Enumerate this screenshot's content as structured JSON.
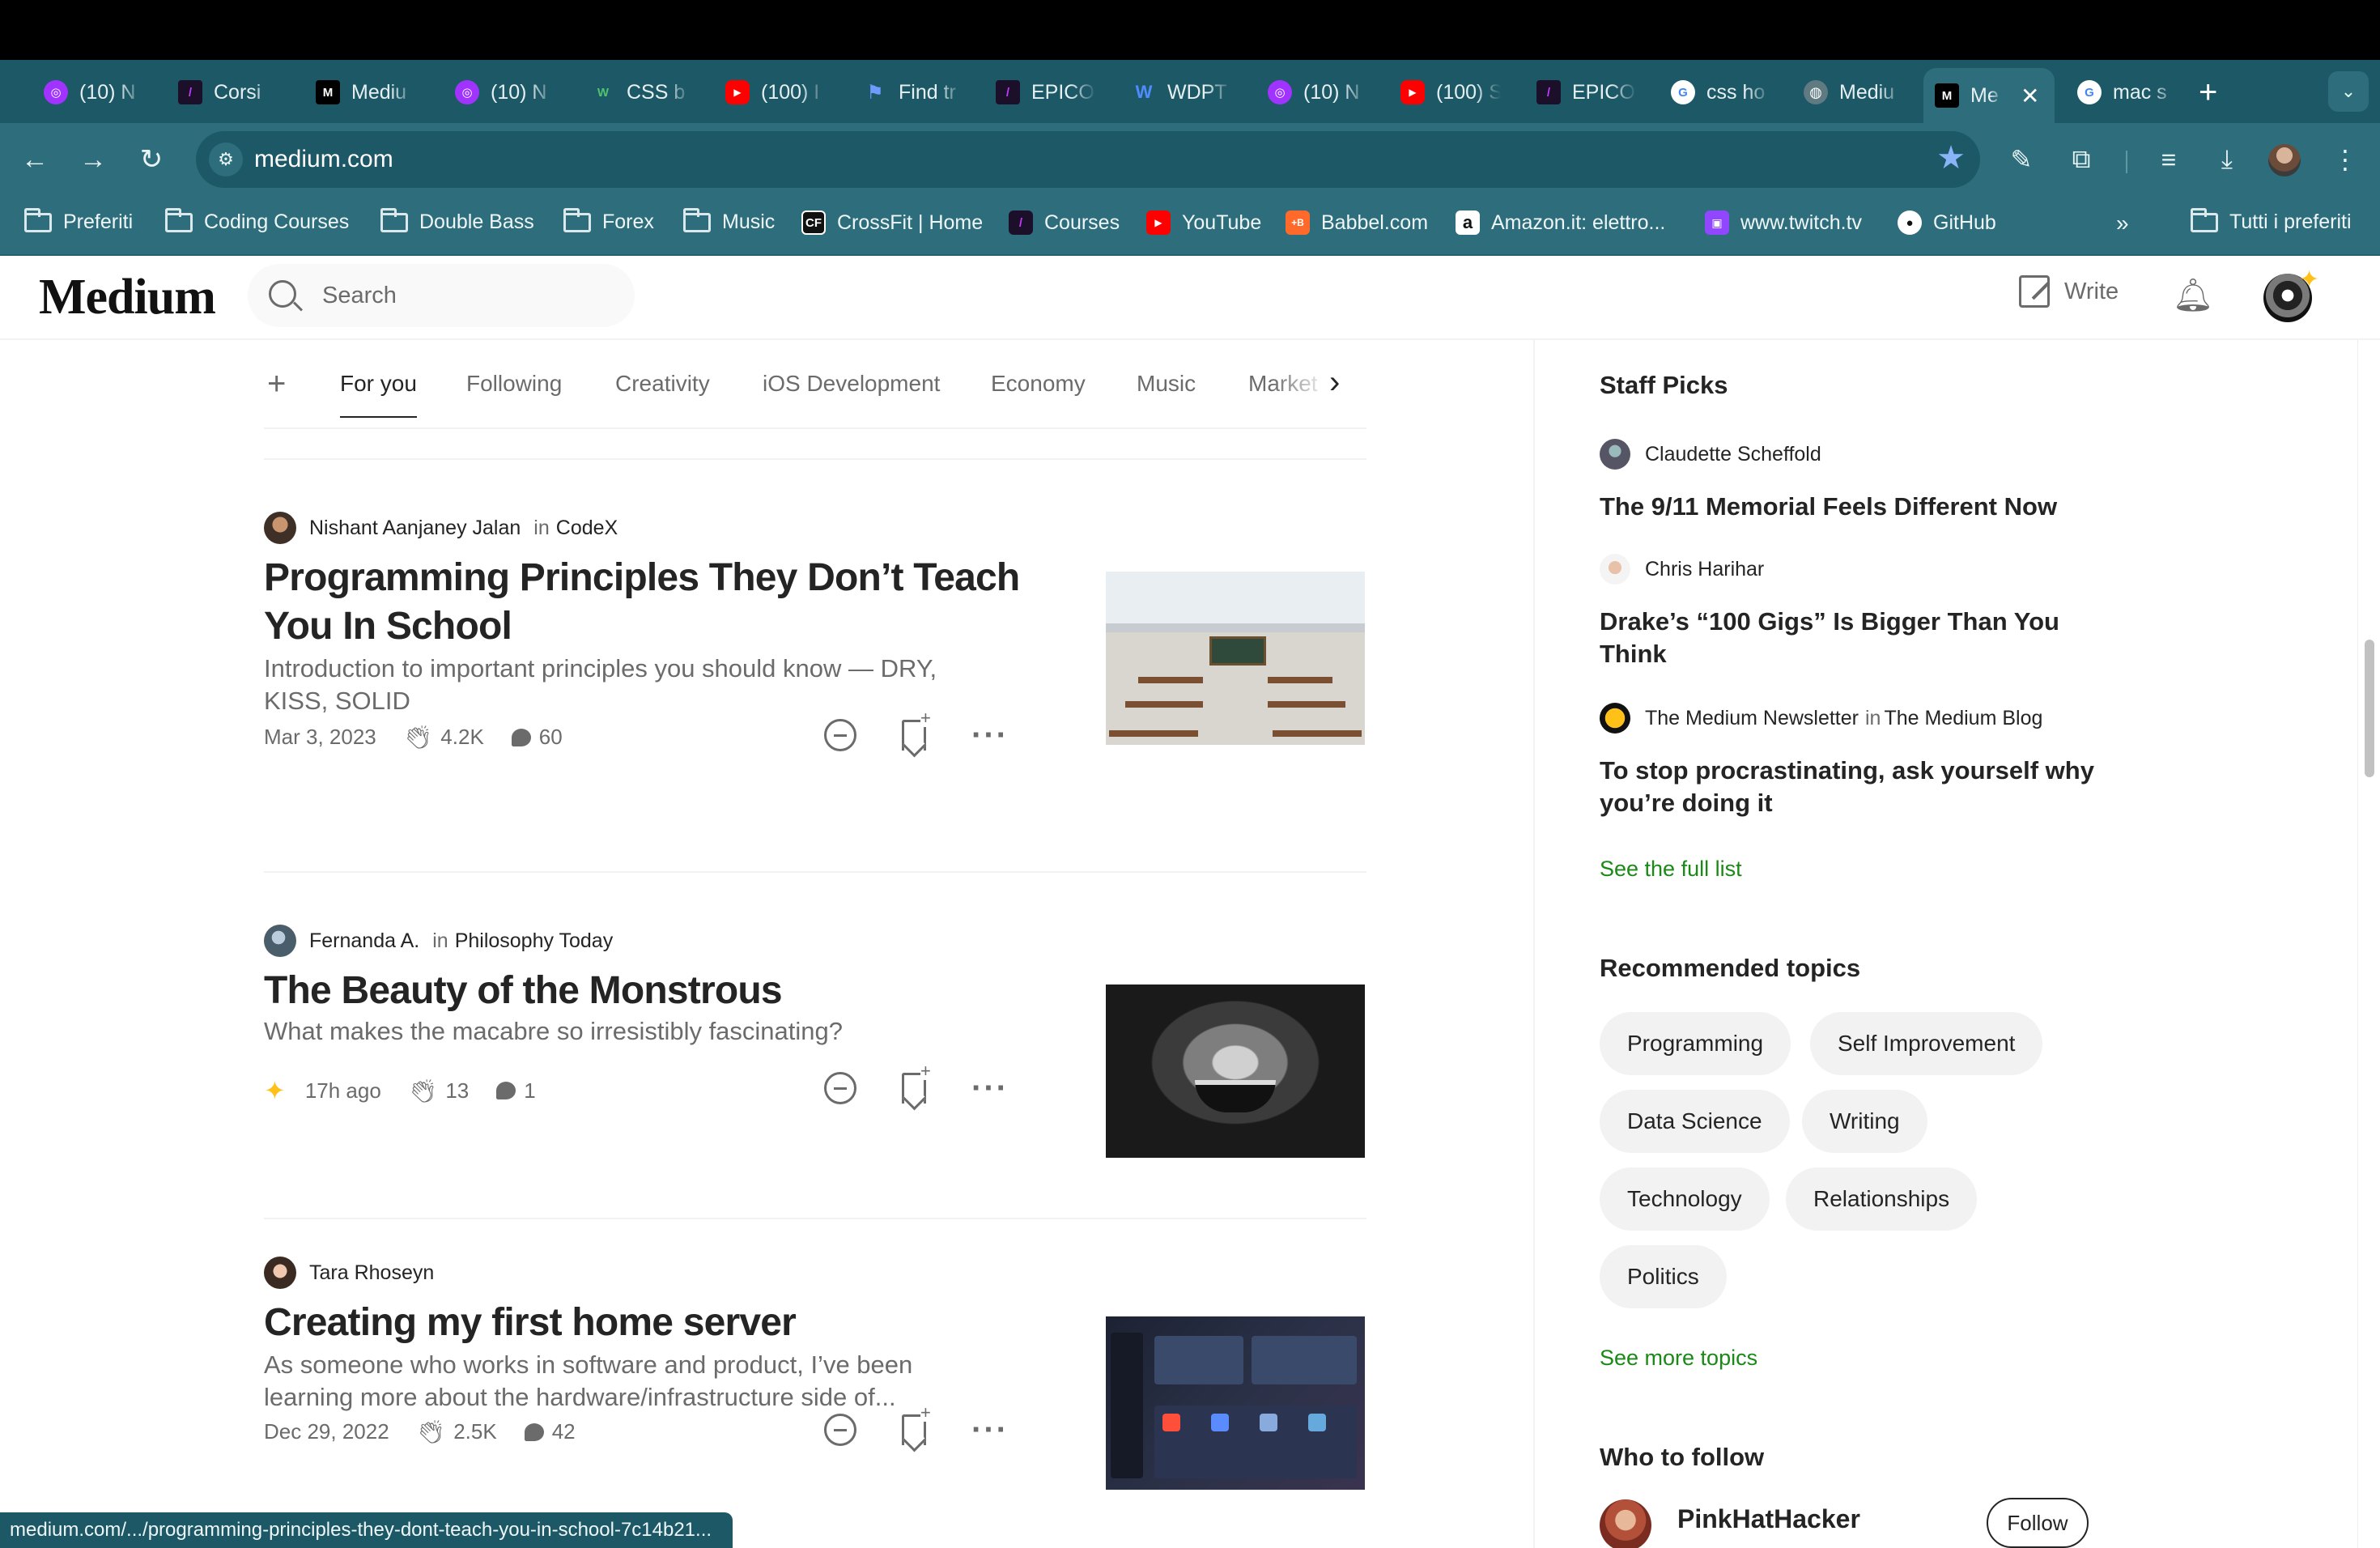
{
  "browser": {
    "tabs": [
      {
        "label": "(10) N",
        "icon": "messenger-icon",
        "color": "#a033ff"
      },
      {
        "label": "Corsi",
        "icon": "epicode-icon",
        "color": "#1b0f2a"
      },
      {
        "label": "Mediu",
        "icon": "medium-icon",
        "color": "#000000"
      },
      {
        "label": "(10) N",
        "icon": "messenger-icon",
        "color": "#a033ff"
      },
      {
        "label": "CSS b",
        "icon": "w-icon",
        "color": "#2f7a3a"
      },
      {
        "label": "(100) I",
        "icon": "youtube-icon",
        "color": "#ff0000"
      },
      {
        "label": "Find tr",
        "icon": "flag-icon",
        "color": "#4a7cff"
      },
      {
        "label": "EPICO",
        "icon": "epicode-icon",
        "color": "#1b0f2a"
      },
      {
        "label": "WDPT",
        "icon": "webflow-icon",
        "color": "#2d6cff"
      },
      {
        "label": "(10) N",
        "icon": "messenger-icon",
        "color": "#a033ff"
      },
      {
        "label": "(100) S",
        "icon": "youtube-icon",
        "color": "#ff0000"
      },
      {
        "label": "EPICO",
        "icon": "epicode-icon",
        "color": "#1b0f2a"
      },
      {
        "label": "css ho",
        "icon": "google-icon",
        "color": "#ffffff"
      },
      {
        "label": "Mediu",
        "icon": "globe-icon",
        "color": "#5f7a80"
      },
      {
        "label": "Me",
        "icon": "medium-icon",
        "color": "#000000",
        "active": true
      },
      {
        "label": "mac s",
        "icon": "google-icon",
        "color": "#ffffff"
      }
    ],
    "url": "medium.com",
    "bookmarks": [
      {
        "label": "Preferiti",
        "type": "folder"
      },
      {
        "label": "Coding Courses",
        "type": "folder"
      },
      {
        "label": "Double Bass",
        "type": "folder"
      },
      {
        "label": "Forex",
        "type": "folder"
      },
      {
        "label": "Music",
        "type": "folder"
      },
      {
        "label": "CrossFit | Home",
        "type": "site",
        "badge": "CF",
        "color": "#111111"
      },
      {
        "label": "Courses",
        "type": "site",
        "badge": "",
        "color": "#1b0f2a"
      },
      {
        "label": "YouTube",
        "type": "site",
        "badge": "▶",
        "color": "#ff0000"
      },
      {
        "label": "Babbel.com",
        "type": "site",
        "badge": "+B",
        "color": "#ff6a2b"
      },
      {
        "label": "Amazon.it: elettro...",
        "type": "site",
        "badge": "a",
        "color": "#ffffff"
      },
      {
        "label": "www.twitch.tv",
        "type": "site",
        "badge": "",
        "color": "#9146ff"
      },
      {
        "label": "GitHub",
        "type": "site",
        "badge": "",
        "color": "#ffffff"
      },
      {
        "label": "Tutti i preferiti",
        "type": "folder"
      }
    ],
    "overflow": "»",
    "status_url": "medium.com/.../programming-principles-they-dont-teach-you-in-school-7c14b21..."
  },
  "header": {
    "logo": "Medium",
    "search_placeholder": "Search",
    "write_label": "Write"
  },
  "feed_tabs": [
    "For you",
    "Following",
    "Creativity",
    "iOS Development",
    "Economy",
    "Music",
    "Market"
  ],
  "articles": [
    {
      "author": "Nishant Aanjaney Jalan",
      "in_label": "in",
      "publication": "CodeX",
      "title": "Programming Principles They Don’t Teach You In School",
      "subtitle": "Introduction to important principles you should know — DRY, KISS, SOLID",
      "date": "Mar 3, 2023",
      "claps": "4.2K",
      "comments": "60"
    },
    {
      "author": "Fernanda A.",
      "in_label": "in",
      "publication": "Philosophy Today",
      "title": "The Beauty of the Monstrous",
      "subtitle": "What makes the macabre so irresistibly fascinating?",
      "date": "17h ago",
      "claps": "13",
      "comments": "1"
    },
    {
      "author": "Tara Rhoseyn",
      "title": "Creating my first home server",
      "subtitle": "As someone who works in software and product, I’ve been learning more about the hardware/infrastructure side of...",
      "date": "Dec 29, 2022",
      "claps": "2.5K",
      "comments": "42"
    }
  ],
  "sidebar": {
    "staff_picks_heading": "Staff Picks",
    "picks": [
      {
        "author": "Claudette Scheffold",
        "title": "The 9/11 Memorial Feels Different Now"
      },
      {
        "author": "Chris Harihar",
        "title": "Drake’s “100 Gigs” Is Bigger Than You Think"
      },
      {
        "author": "The Medium Newsletter",
        "in_label": "in",
        "publication": "The Medium Blog",
        "title": "To stop procrastinating, ask yourself why you’re doing it"
      }
    ],
    "see_full_list": "See the full list",
    "topics_heading": "Recommended topics",
    "topics": [
      "Programming",
      "Self Improvement",
      "Data Science",
      "Writing",
      "Technology",
      "Relationships",
      "Politics"
    ],
    "see_more_topics": "See more topics",
    "who_to_follow_heading": "Who to follow",
    "follow_suggestion": {
      "name": "PinkHatHacker",
      "button": "Follow"
    }
  },
  "colors": {
    "tabbar": "#1d5866",
    "toolbar": "#2e6d7b",
    "accent_green": "#1a8917",
    "star_yellow": "#ffc017",
    "text_primary": "#242424",
    "text_secondary": "#6b6b6b"
  }
}
